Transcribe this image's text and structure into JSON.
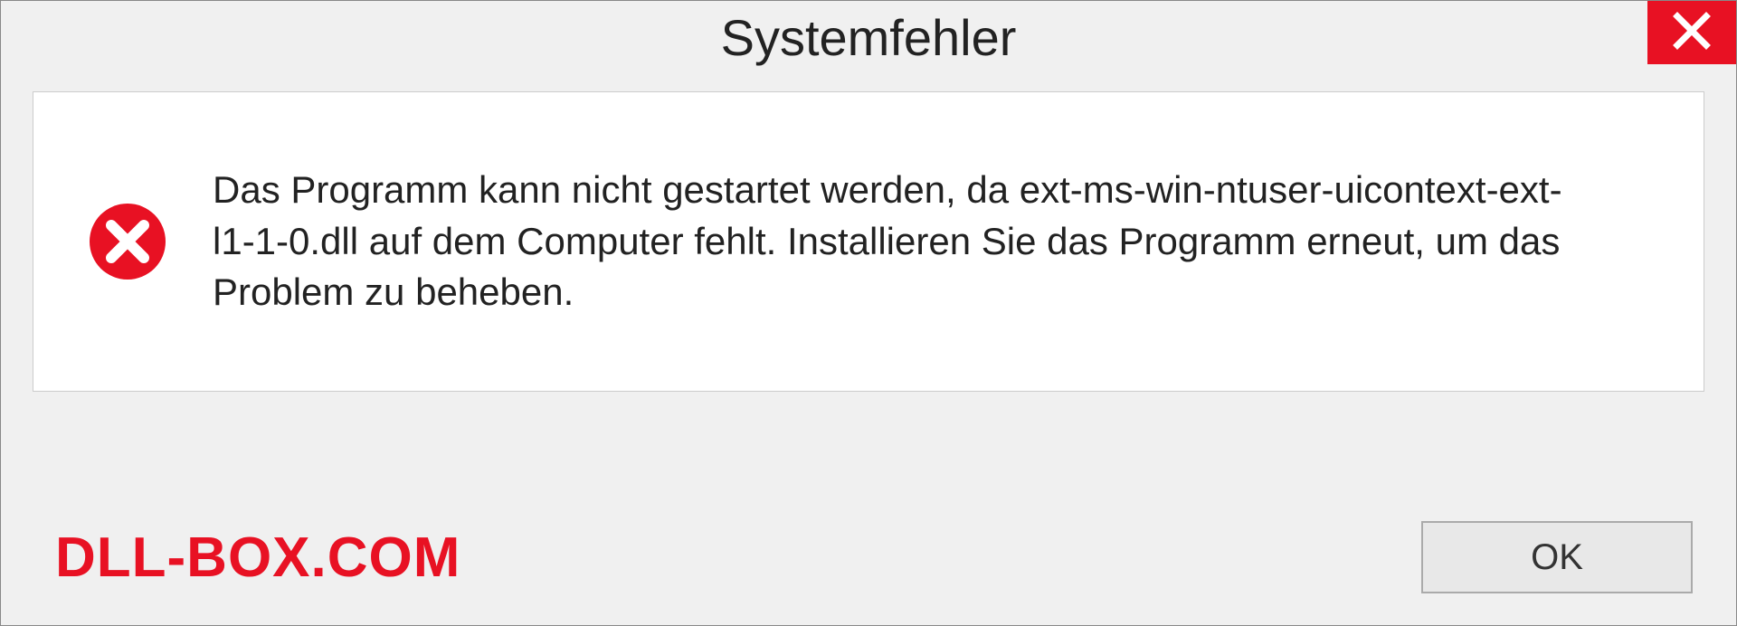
{
  "dialog": {
    "title": "Systemfehler",
    "message": "Das Programm kann nicht gestartet werden, da ext-ms-win-ntuser-uicontext-ext-l1-1-0.dll auf dem Computer fehlt. Installieren Sie das Programm erneut, um das Problem zu beheben.",
    "ok_label": "OK"
  },
  "watermark": "DLL-BOX.COM"
}
